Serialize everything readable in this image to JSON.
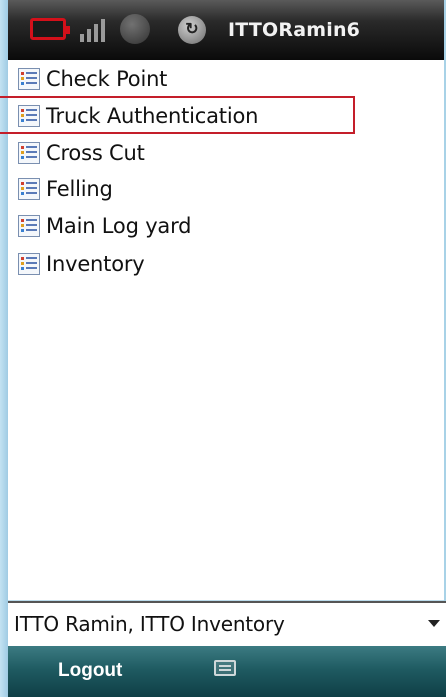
{
  "status_bar": {
    "app_title": "ITTORamin6",
    "icons": [
      "battery-icon",
      "signal-icon",
      "sync-icon",
      "sync-icon"
    ]
  },
  "menu": {
    "items": [
      {
        "label": "Check Point"
      },
      {
        "label": "Truck Authentication"
      },
      {
        "label": "Cross Cut"
      },
      {
        "label": "Felling"
      },
      {
        "label": "Main Log yard"
      },
      {
        "label": "Inventory"
      }
    ],
    "selected_index": 1,
    "selection_color": "#c41e2a"
  },
  "dropdown": {
    "selected_value": "ITTO Ramin, ITTO Inventory"
  },
  "soft_keys": {
    "left_label": "Logout",
    "right_icon": "keyboard-icon"
  }
}
